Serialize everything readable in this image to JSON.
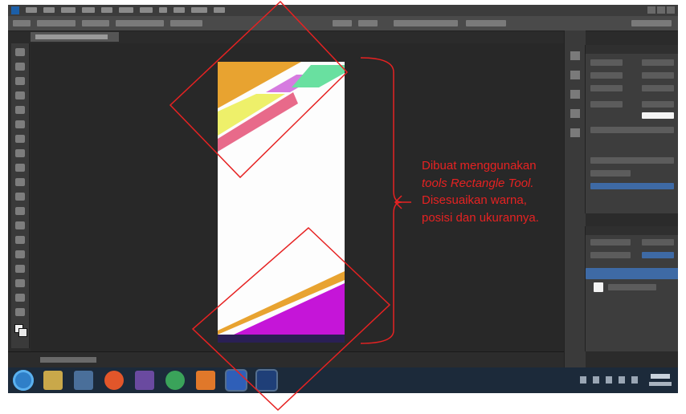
{
  "annotation": {
    "line1": "Dibuat menggunakan",
    "line2": "tools Rectangle Tool.",
    "line3": "Disesuaikan warna,",
    "line4": "posisi  dan ukurannya."
  },
  "colors": {
    "annotation": "#e62222",
    "workspace": "#2b2b2b",
    "artboard": "#fdfdfd",
    "stripe_orange": "#e8a330",
    "stripe_pink": "#e86a8a",
    "stripe_violet": "#d67be0",
    "stripe_mint": "#69e0a0",
    "stripe_yellow": "#eef06a",
    "stripe_magenta": "#c515d8",
    "bottom_band": "#2a1f55"
  },
  "taskbar": {
    "apps": [
      "start-orb",
      "file-explorer-icon",
      "media-player-icon",
      "firefox-icon",
      "visual-studio-icon",
      "chrome-icon",
      "paint-icon",
      "word-icon",
      "photoshop-icon"
    ]
  }
}
